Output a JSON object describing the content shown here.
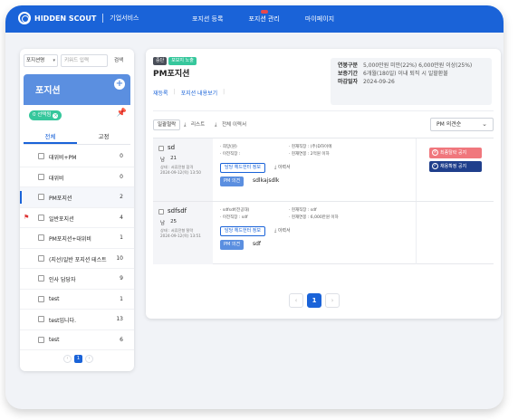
{
  "header": {
    "brand": "HIDDEN SCOUT",
    "brand_sub": "기업서비스",
    "nav": [
      "포지션 등록",
      "포지션 관리",
      "마이페이지"
    ]
  },
  "sidebar": {
    "filter_select": "포지션명",
    "search_placeholder": "키워드 입력",
    "search_button": "검색",
    "title": "포지션",
    "selected_chip": "0 선택됨",
    "tabs": [
      "전체",
      "고정"
    ],
    "items": [
      {
        "label": "대위비+PM",
        "count": "0"
      },
      {
        "label": "대위비",
        "count": "0"
      },
      {
        "label": "PM포지션",
        "count": "2"
      },
      {
        "label": "일반포지션",
        "count": "4"
      },
      {
        "label": "PM포지션+대위비",
        "count": "1"
      },
      {
        "label": "(지선)일반 포지션 테스트",
        "count": "10"
      },
      {
        "label": "인사 담당자",
        "count": "9"
      },
      {
        "label": "test",
        "count": "1"
      },
      {
        "label": "test입니다.",
        "count": "13"
      },
      {
        "label": "test",
        "count": "6"
      }
    ],
    "pager": {
      "prev": "‹",
      "current": "1",
      "next": "›"
    }
  },
  "position": {
    "badge_status": "중단",
    "badge_exposure": "포보지 노출",
    "title": "PM포지션",
    "link_reopen": "재등록",
    "link_view": "포지션 내용보기",
    "info": [
      {
        "key": "연봉구분",
        "value": "5,000만원 미만(22%) 6,000만원 이상(25%)"
      },
      {
        "key": "보증기간",
        "value": "6개월(180일) 이내 퇴직 시 일할환불"
      },
      {
        "key": "마감일자",
        "value": "2024-09-26"
      }
    ]
  },
  "toolbar": {
    "bulk": "일괄철락",
    "list": "리스트",
    "resume_all": "전체 이력서",
    "sort": "PM 의견순"
  },
  "candidates": [
    {
      "name": "sd",
      "gender": "남",
      "age": "21",
      "meta1": "상태 : 서류전형 합격",
      "meta2": "2024-09-12(목) 13:50",
      "line1": "· 희망(원)",
      "line2": "· 이전직장 :",
      "line3": "· 현재직장 : (주)D하이에",
      "line4": "· 현재연봉 : 2억원 이하",
      "head_btn": "담당 헤드헌터 정보",
      "resume": "이력서",
      "pm_label": "PM 의견",
      "pm_value": "sdlkajsdlk",
      "actions": [
        "최종탈락 공지",
        "채용확정 공지"
      ]
    },
    {
      "name": "sdfsdf",
      "gender": "남",
      "age": "25",
      "meta1": "상태 : 서류전형 탈락",
      "meta2": "2024-09-12(목) 13:51",
      "line1": "· sdfsdf(전공대)",
      "line2": "· 이전직장 : sdf",
      "line3": "· 현재직장 : sdf",
      "line4": "· 현재연봉 : 6,000만원 이하",
      "head_btn": "담당 헤드헌터 정보",
      "resume": "이력서",
      "pm_label": "PM 의견",
      "pm_value": "sdf"
    }
  ],
  "pager": {
    "prev": "‹",
    "current": "1",
    "next": "›"
  }
}
